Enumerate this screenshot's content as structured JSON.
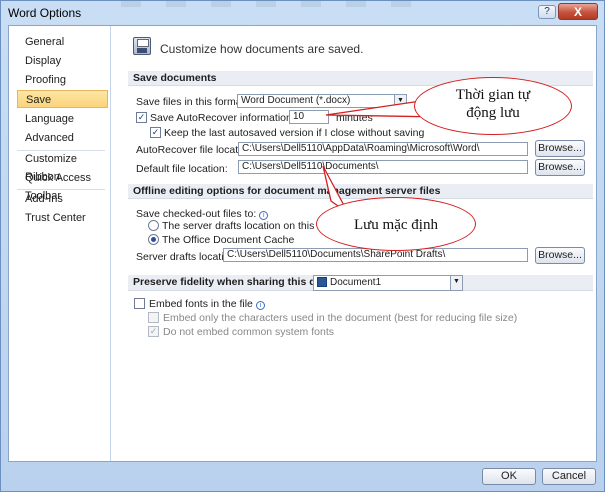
{
  "window": {
    "title": "Word Options",
    "help": "?",
    "close": "X"
  },
  "nav": {
    "items": [
      {
        "label": "General"
      },
      {
        "label": "Display"
      },
      {
        "label": "Proofing"
      },
      {
        "label": "Save"
      },
      {
        "label": "Language"
      },
      {
        "label": "Advanced"
      },
      {
        "label": "Customize Ribbon"
      },
      {
        "label": "Quick Access Toolbar"
      },
      {
        "label": "Add-Ins"
      },
      {
        "label": "Trust Center"
      }
    ],
    "selected": "Save"
  },
  "header": {
    "text": "Customize how documents are saved."
  },
  "save_documents": {
    "section_title": "Save documents",
    "format_label": "Save files in this format:",
    "format_value": "Word Document (*.docx)",
    "autorecover_label": "Save AutoRecover information every",
    "autorecover_checked": true,
    "autorecover_minutes": "10",
    "minutes_label": "minutes",
    "keep_last_label": "Keep the last autosaved version if I close without saving",
    "keep_last_checked": true,
    "autorecover_location_label": "AutoRecover file location:",
    "autorecover_location_value": "C:\\Users\\Dell5110\\AppData\\Roaming\\Microsoft\\Word\\",
    "default_location_label": "Default file location:",
    "default_location_value": "C:\\Users\\Dell5110\\Documents\\",
    "browse_label": "Browse..."
  },
  "offline": {
    "section_title": "Offline editing options for document management server files",
    "checked_out_label": "Save checked-out files to:",
    "option_server": "The server drafts location on this computer",
    "option_cache": "The Office Document Cache",
    "selected_option": "The Office Document Cache",
    "server_drafts_label": "Server drafts location:",
    "server_drafts_value": "C:\\Users\\Dell5110\\Documents\\SharePoint Drafts\\",
    "browse_label": "Browse..."
  },
  "fidelity": {
    "section_title": "Preserve fidelity when sharing this document:",
    "document_value": "Document1",
    "embed_fonts_label": "Embed fonts in the file",
    "embed_fonts_checked": false,
    "embed_only_label": "Embed only the characters used in the document (best for reducing file size)",
    "no_common_label": "Do not embed common system fonts",
    "no_common_checked": true
  },
  "footer": {
    "ok": "OK",
    "cancel": "Cancel"
  },
  "annotations": {
    "autosave_time": "Thời gian tự động lưu",
    "default_save": "Lưu mặc định"
  },
  "colors": {
    "accent_selected": "#fbd37a",
    "callout_border": "#d41f1f",
    "section_bg": "#eaeef4"
  }
}
